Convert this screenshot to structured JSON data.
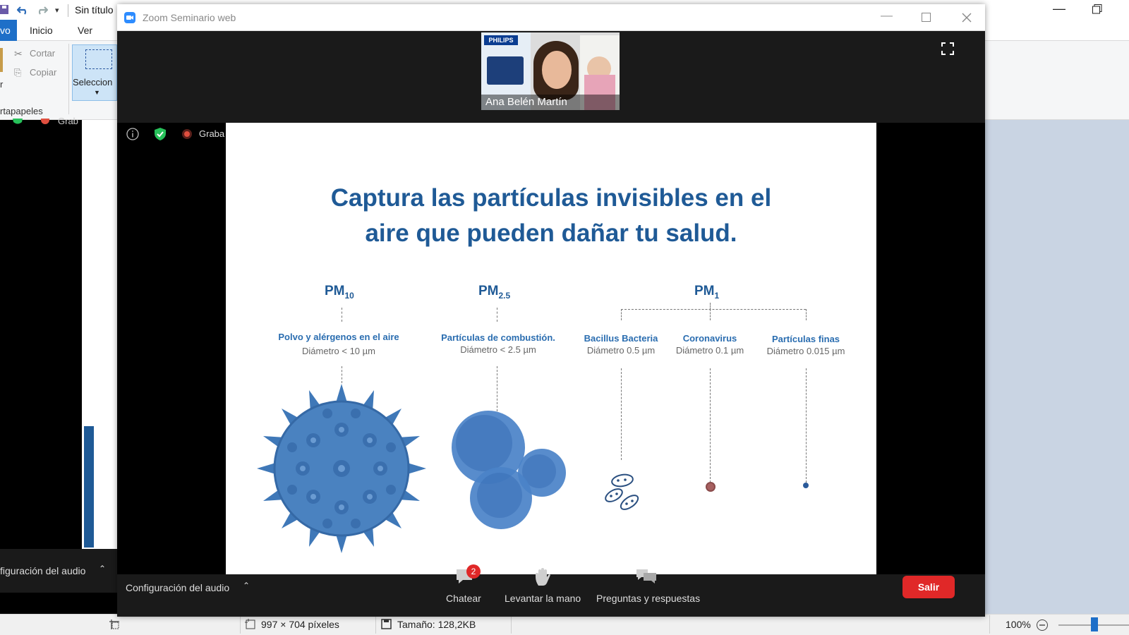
{
  "paint": {
    "title": "Sin título",
    "tabs": [
      "vo",
      "Inicio",
      "Ver"
    ],
    "clipboard": {
      "cut": "Cortar",
      "copy": "Copiar",
      "group": "rtapapeles",
      "paste_fragment": "r"
    },
    "select_label": "Seleccion",
    "status": {
      "dimensions": "997 × 704 píxeles",
      "size": "Tamaño: 128,2KB",
      "zoom": "100%"
    }
  },
  "background_zoom": {
    "audio_label": "figuración del audio",
    "recording_fragment": "Grab"
  },
  "zoom": {
    "window_title": "Zoom Seminario web",
    "participant_name": "Ana Belén Martín",
    "recording_label": "Graba",
    "audio_settings": "Configuración del audio",
    "toolbar": {
      "chat": "Chatear",
      "chat_badge": "2",
      "raise_hand": "Levantar la mano",
      "qa": "Preguntas y respuestas",
      "leave": "Salir"
    },
    "slide": {
      "title_line1": "Captura las partículas invisibles en el",
      "title_line2": "aire que pueden dañar tu salud.",
      "pm10": {
        "main": "PM",
        "sub": "10",
        "title": "Polvo y alérgenos en el aire",
        "diameter": "Diámetro < 10 µm"
      },
      "pm25": {
        "main": "PM",
        "sub": "2.5",
        "title": "Partículas de combustión.",
        "diameter": "Diámetro < 2.5 µm"
      },
      "pm1": {
        "main": "PM",
        "sub": "1"
      },
      "bacillus": {
        "title": "Bacillus Bacteria",
        "diameter": "Diámetro 0.5 µm"
      },
      "corona": {
        "title": "Coronavirus",
        "diameter": "Diámetro 0.1 µm"
      },
      "fine": {
        "title": "Partículas finas",
        "diameter": "Diámetro 0.015 µm"
      }
    },
    "video_logo": "PHILIPS"
  },
  "colors": {
    "zoom_blue": "#2d8cff",
    "leave_red": "#e02828",
    "slide_blue": "#1f5a96",
    "particle_blue": "#3f78b8"
  }
}
